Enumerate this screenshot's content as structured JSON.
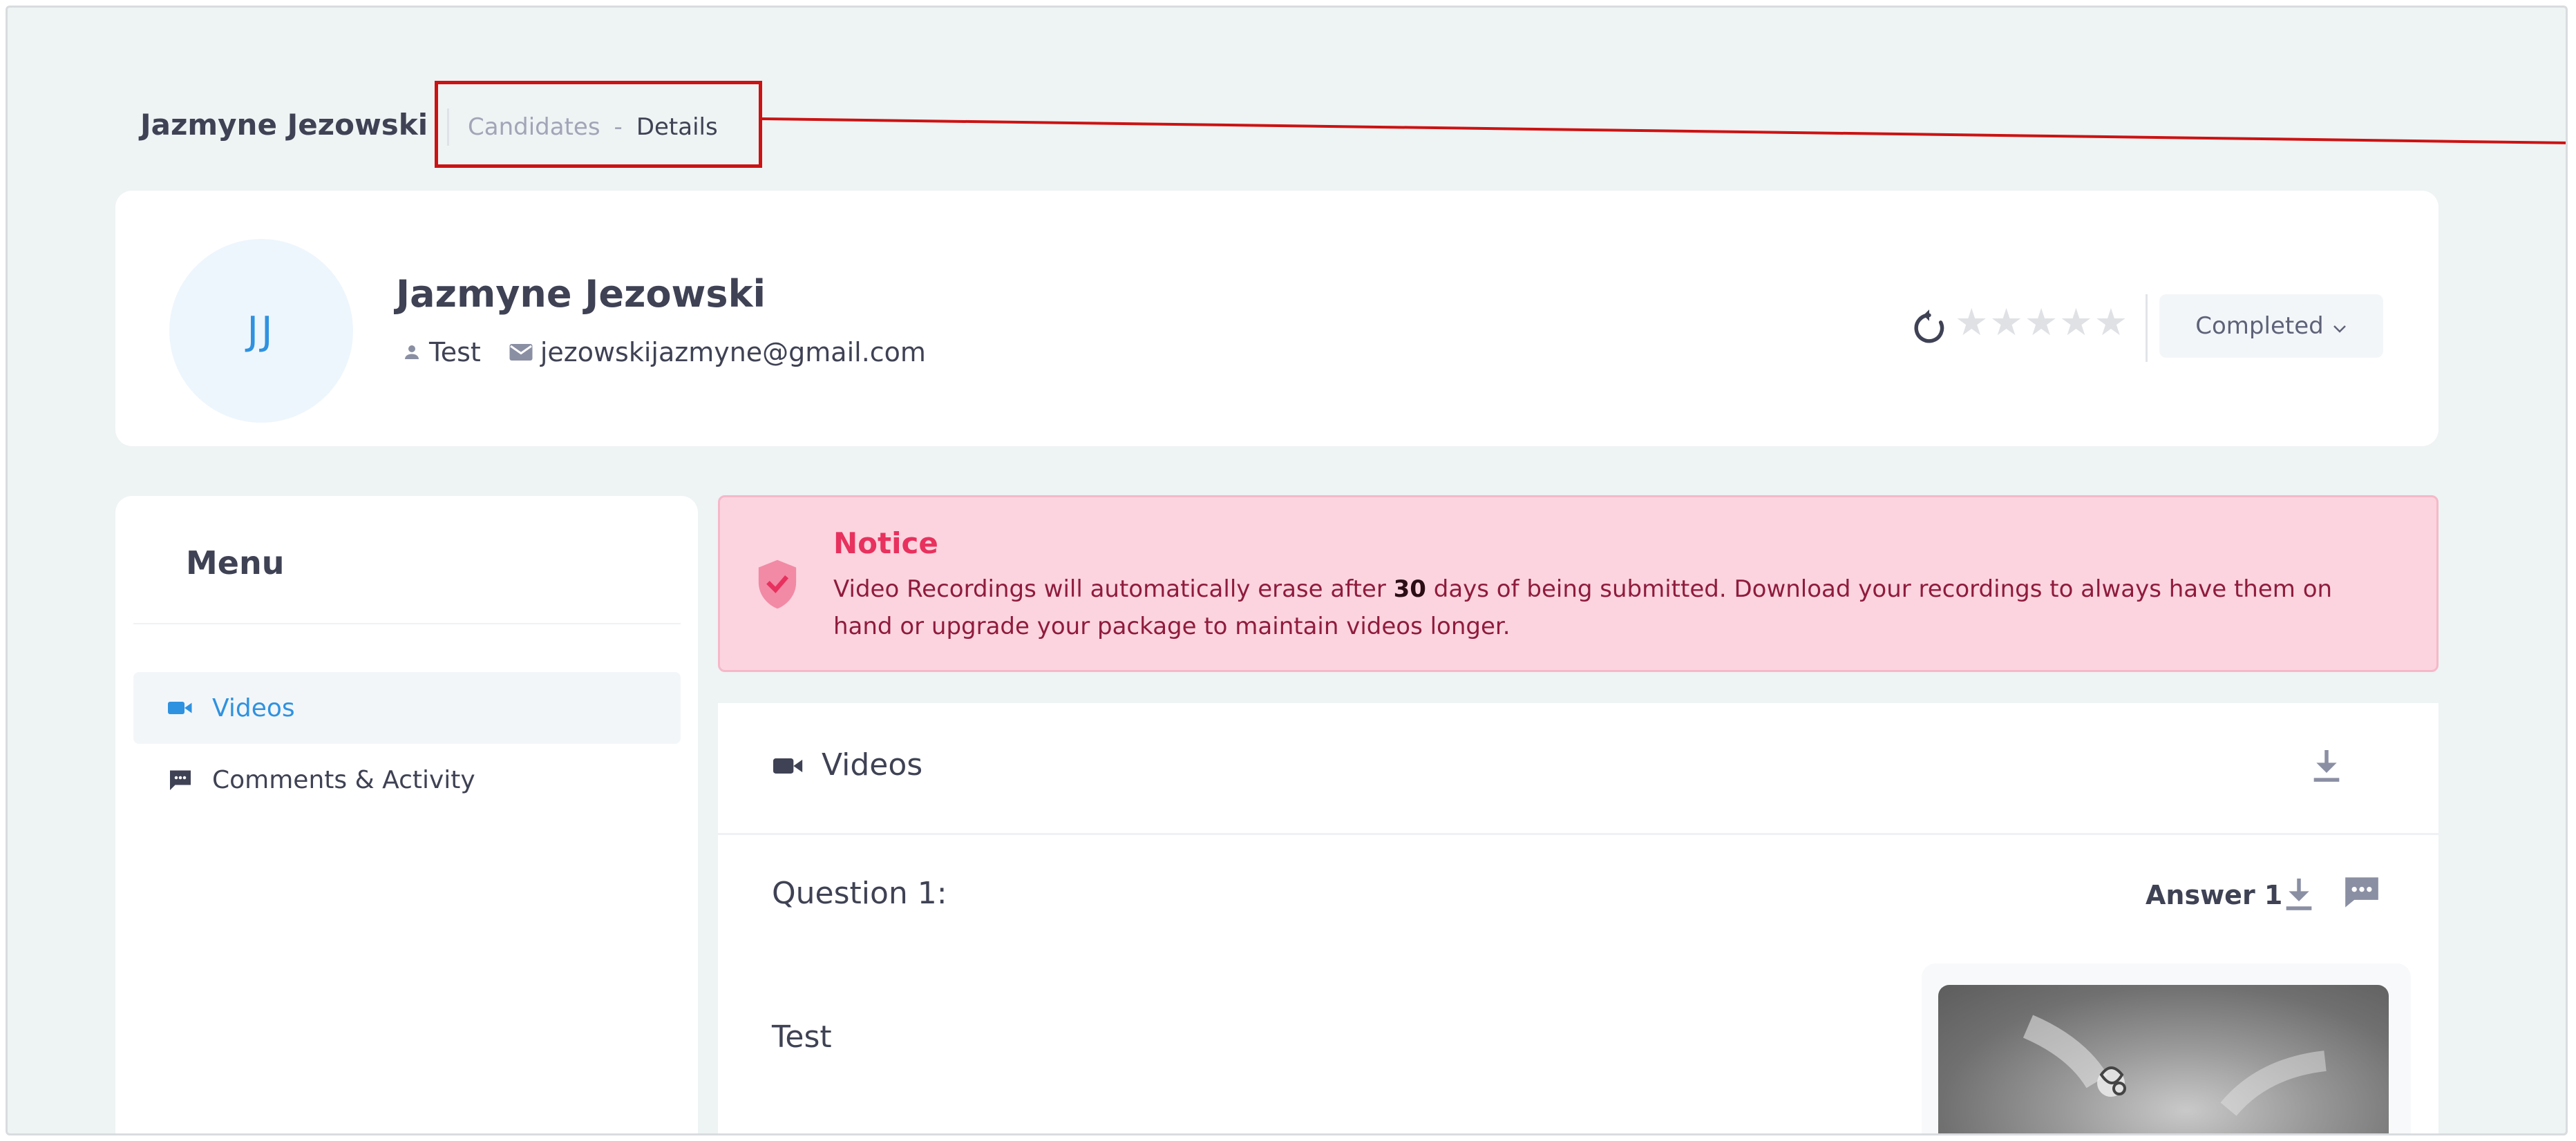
{
  "page": {
    "title": "Jazmyne Jezowski",
    "breadcrumb": {
      "parent": "Candidates",
      "separator": "-",
      "current": "Details"
    }
  },
  "candidate": {
    "initials": "JJ",
    "name": "Jazmyne Jezowski",
    "role": "Test",
    "email": "jezowskijazmyne@gmail.com",
    "rating": 0,
    "rating_max": 5,
    "status": "Completed"
  },
  "menu": {
    "title": "Menu",
    "items": [
      {
        "label": "Videos",
        "icon": "video-camera-icon",
        "active": true
      },
      {
        "label": "Comments & Activity",
        "icon": "comment-icon",
        "active": false
      }
    ]
  },
  "notice": {
    "title": "Notice",
    "text_before": "Video Recordings will automatically erase after ",
    "days": "30",
    "text_after": " days of being submitted. Download your recordings to always have them on hand or upgrade your package to maintain videos longer."
  },
  "videos": {
    "title": "Videos",
    "question_label": "Question 1:",
    "answer_label": "Answer 1",
    "question_text": "Test"
  },
  "colors": {
    "accent": "#2f92e0",
    "notice_bg": "#fbd4df",
    "notice_title": "#e8315e",
    "highlight": "#cc1212"
  }
}
